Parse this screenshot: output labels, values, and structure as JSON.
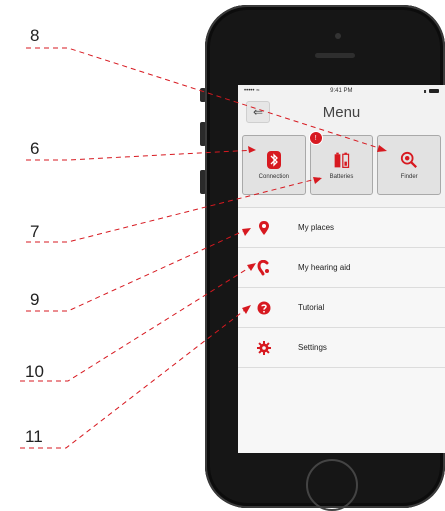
{
  "callouts": [
    "8",
    "6",
    "7",
    "9",
    "10",
    "11"
  ],
  "status_bar": {
    "carrier": "•••••",
    "wifi": "≈",
    "time": "9:41 PM",
    "battery_dot": "∎"
  },
  "nav": {
    "back_glyph": "⇐",
    "title": "Menu"
  },
  "tiles": [
    {
      "label": "Connection",
      "icon": "bluetooth-icon"
    },
    {
      "label": "Batteries",
      "icon": "battery-icon",
      "badge": "!"
    },
    {
      "label": "Finder",
      "icon": "finder-icon"
    }
  ],
  "menu": [
    {
      "label": "My places",
      "icon": "map-pin-icon"
    },
    {
      "label": "My hearing aid",
      "icon": "hearing-aid-icon"
    },
    {
      "label": "Tutorial",
      "icon": "help-icon"
    },
    {
      "label": "Settings",
      "icon": "gear-icon"
    }
  ],
  "colors": {
    "accent": "#d71920",
    "callout_line": "#d71920"
  }
}
